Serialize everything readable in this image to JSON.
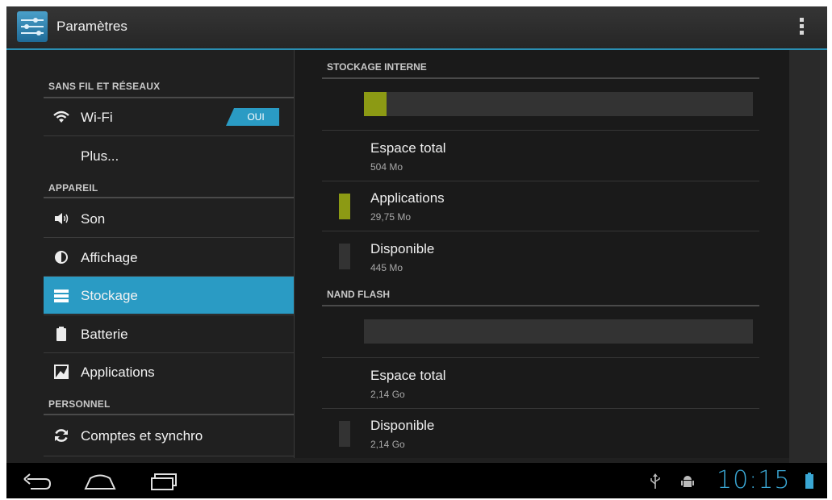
{
  "app": {
    "title": "Paramètres"
  },
  "left_nav": {
    "sections": [
      {
        "label": "SANS FIL ET RÉSEAUX"
      },
      {
        "label": "APPAREIL"
      },
      {
        "label": "PERSONNEL"
      }
    ],
    "items": [
      {
        "label": "Wi-Fi",
        "icon": "wifi-icon",
        "toggle": "OUI"
      },
      {
        "label": "Plus..."
      },
      {
        "label": "Son",
        "icon": "speaker-icon"
      },
      {
        "label": "Affichage",
        "icon": "brightness-icon"
      },
      {
        "label": "Stockage",
        "icon": "storage-icon",
        "selected": true
      },
      {
        "label": "Batterie",
        "icon": "battery-icon"
      },
      {
        "label": "Applications",
        "icon": "applications-icon"
      },
      {
        "label": "Comptes et synchro",
        "icon": "sync-icon"
      }
    ]
  },
  "storage": {
    "internal": {
      "header": "STOCKAGE INTERNE",
      "usage_fraction": 0.059,
      "rows": [
        {
          "title": "Espace total",
          "value": "504 Mo"
        },
        {
          "title": "Applications",
          "value": "29,75 Mo",
          "color": "#8c9a14"
        },
        {
          "title": "Disponible",
          "value": "445 Mo",
          "color": "#333333"
        }
      ]
    },
    "nand": {
      "header": "NAND FLASH",
      "usage_fraction": 0,
      "rows": [
        {
          "title": "Espace total",
          "value": "2,14 Go"
        },
        {
          "title": "Disponible",
          "value": "2,14 Go",
          "color": "#333333"
        }
      ]
    }
  },
  "system_bar": {
    "time": "10:15",
    "accent": "#3aa7d4",
    "icons": [
      "back-icon",
      "home-icon",
      "recent-apps-icon",
      "usb-icon",
      "android-debug-icon",
      "battery-status-icon"
    ]
  },
  "colors": {
    "accent": "#2a9bc4",
    "apps_usage": "#8c9a14"
  }
}
